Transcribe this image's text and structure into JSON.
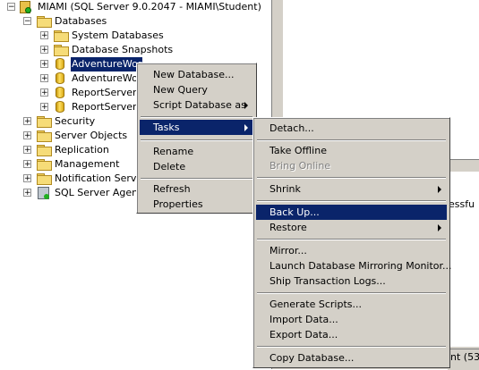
{
  "tree": {
    "server": "MIAMI (SQL Server 9.0.2047 - MIAMI\\Student)",
    "items": [
      {
        "label": "Databases"
      },
      {
        "label": "System Databases"
      },
      {
        "label": "Database Snapshots"
      },
      {
        "label": "AdventureWor"
      },
      {
        "label": "AdventureWor"
      },
      {
        "label": "ReportServer"
      },
      {
        "label": "ReportServerT"
      },
      {
        "label": "Security"
      },
      {
        "label": "Server Objects"
      },
      {
        "label": "Replication"
      },
      {
        "label": "Management"
      },
      {
        "label": "Notification Service"
      },
      {
        "label": "SQL Server Agent"
      }
    ]
  },
  "context_menu": {
    "items": [
      "New Database...",
      "New Query",
      "Script Database as",
      "Tasks",
      "Rename",
      "Delete",
      "Refresh",
      "Properties"
    ]
  },
  "tasks_menu": {
    "items": [
      "Detach...",
      "Take Offline",
      "Bring Online",
      "Shrink",
      "Back Up...",
      "Restore",
      "Mirror...",
      "Launch Database Mirroring Monitor...",
      "Ship Transaction Logs...",
      "Generate Scripts...",
      "Import Data...",
      "Export Data...",
      "Copy Database..."
    ]
  },
  "output": {
    "text": "essfu"
  },
  "status": {
    "text": "nt (53)"
  }
}
